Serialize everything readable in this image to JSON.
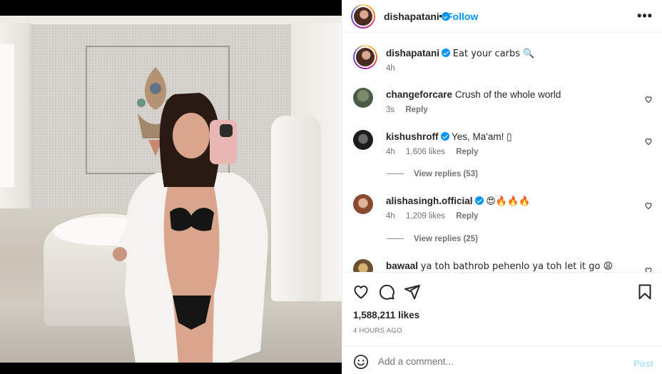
{
  "post": {
    "author": "dishapatani",
    "follow_label": "Follow",
    "separator": "•",
    "more_label": "•••",
    "caption": {
      "username": "dishapatani",
      "text": "Eat your carbs 🔍",
      "time": "4h"
    }
  },
  "comments": [
    {
      "username": "changeforcare",
      "text": "Crush of the whole world",
      "time": "3s",
      "likes": "",
      "reply": "Reply",
      "verified": false
    },
    {
      "username": "kishushroff",
      "text": "Yes, Ma'am! ▯",
      "time": "4h",
      "likes": "1,606 likes",
      "reply": "Reply",
      "verified": true,
      "view_replies": "View replies (53)"
    },
    {
      "username": "alishasingh.official",
      "text": "😍🔥🔥🔥",
      "time": "4h",
      "likes": "1,209 likes",
      "reply": "Reply",
      "verified": true,
      "view_replies": "View replies (25)"
    },
    {
      "username": "bawaal",
      "text": "ya toh bathrob pehenlo ya toh let it go 😩",
      "time": "",
      "likes": "",
      "reply": "",
      "verified": false
    }
  ],
  "stats": {
    "likes": "1,588,211 likes",
    "posted": "4 HOURS AGO"
  },
  "add_comment": {
    "placeholder": "Add a comment...",
    "post_label": "Post"
  },
  "icons": {
    "like": "heart-icon",
    "comment": "comment-icon",
    "share": "share-icon",
    "save": "bookmark-icon",
    "emoji": "emoji-icon",
    "more": "more-icon"
  },
  "colors": {
    "accent": "#0095f6",
    "post_disabled": "#b2dffc",
    "muted": "#737373"
  }
}
